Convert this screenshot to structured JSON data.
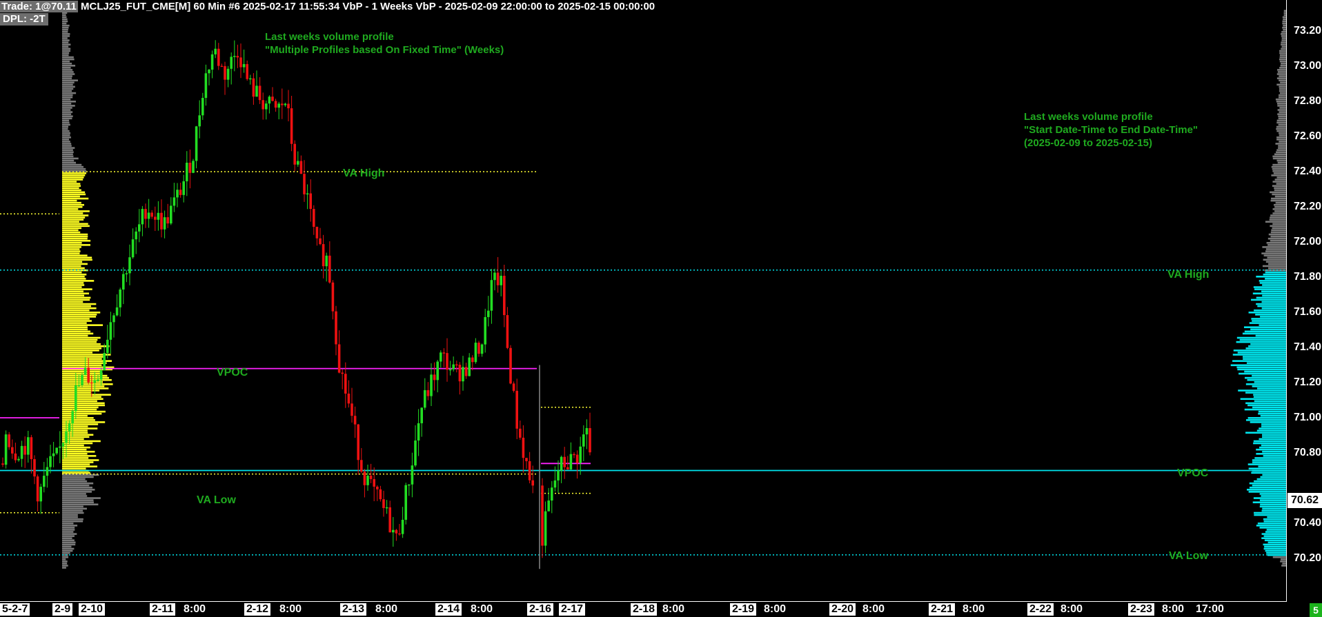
{
  "header": {
    "trade_tag": "Trade: 1@70.11",
    "info": " MCLJ25_FUT_CME[M]  60 Min  #6 2025-02-17 11:55:34 VbP - 1 Weeks  VbP - 2025-02-09  22:00:00 to 2025-02-15  00:00:00",
    "dpl": "DPL: -2T"
  },
  "notes": {
    "left_line1": "Last weeks volume profile",
    "left_line2": "\"Multiple Profiles based On Fixed Time\" (Weeks)",
    "right_line1": "Last weeks volume profile",
    "right_line2": "\"Start Date-Time to End Date-Time\"",
    "right_line3": "(2025-02-09 to 2025-02-15)"
  },
  "labels": {
    "left_va_high": "VA High",
    "left_vpoc": "VPOC",
    "left_va_low": "VA Low",
    "right_va_high": "VA High",
    "right_vpoc": "VPOC",
    "right_va_low": "VA Low"
  },
  "price_axis": {
    "ticks": [
      "73.20",
      "73.00",
      "72.80",
      "72.60",
      "72.40",
      "72.20",
      "72.00",
      "71.80",
      "71.60",
      "71.40",
      "71.20",
      "71.00",
      "70.80",
      "70.40",
      "70.20"
    ],
    "current_price": "70.62"
  },
  "time_axis": {
    "dates": [
      {
        "label": "5-2-7"
      },
      {
        "label": "2-9"
      },
      {
        "label": "2-10"
      },
      {
        "label": "2-11"
      },
      {
        "label": "2-12"
      },
      {
        "label": "2-13"
      },
      {
        "label": "2-14"
      },
      {
        "label": "2-16"
      },
      {
        "label": "2-17"
      },
      {
        "label": "2-18"
      },
      {
        "label": "2-19"
      },
      {
        "label": "2-20"
      },
      {
        "label": "2-21"
      },
      {
        "label": "2-22"
      },
      {
        "label": "2-23"
      }
    ],
    "times": [
      "8:00",
      "8:00",
      "8:00",
      "8:00",
      "8:00",
      "8:00",
      "8:00",
      "8:00",
      "8:00",
      "8:00",
      "17:00"
    ]
  },
  "corner_badge": "5",
  "colors": {
    "up": "#22dd22",
    "down": "#ee1111",
    "profile_va": "#ffff22",
    "profile_out": "#7a7a7a",
    "profile_right": "#00e6ee",
    "vpoc_left": "#ff22ff",
    "label_green": "#1faa1f"
  },
  "chart_data": {
    "type": "candlestick",
    "symbol": "MCLJ25_FUT_CME[M]",
    "interval": "60 Min",
    "price_range": [
      70.1,
      73.3
    ],
    "levels": {
      "left_va_high": 72.4,
      "left_vpoc": 71.28,
      "left_va_low": 70.68,
      "right_va_high": 71.84,
      "right_vpoc": 70.7,
      "right_va_low": 70.22
    },
    "current_price": 70.62
  }
}
